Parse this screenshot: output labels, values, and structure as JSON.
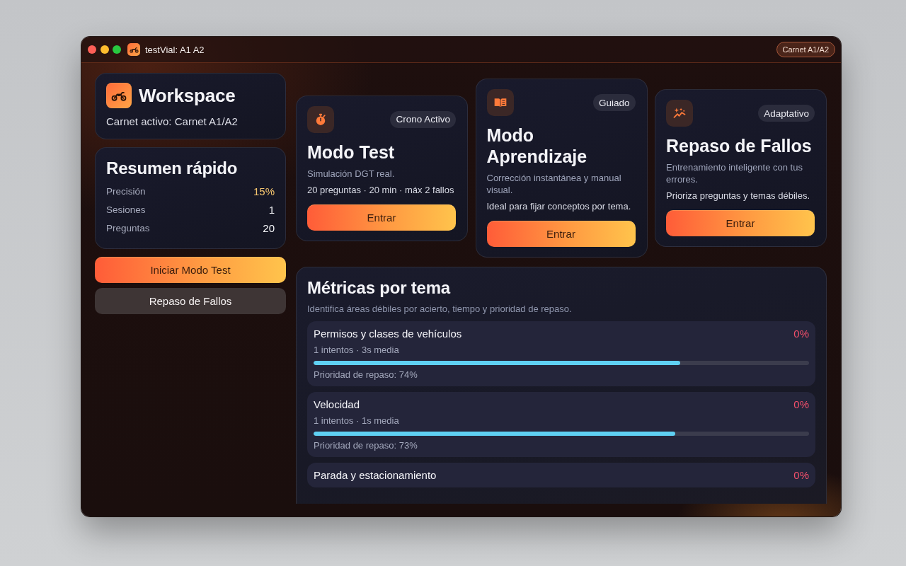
{
  "window": {
    "title": "testVial: A1 A2",
    "badge": "Carnet A1/A2"
  },
  "workspace": {
    "title": "Workspace",
    "subtitle": "Carnet activo: Carnet A1/A2"
  },
  "summary": {
    "title": "Resumen rápido",
    "stats": [
      {
        "label": "Precisión",
        "value": "15%",
        "color": "#f7c66f"
      },
      {
        "label": "Sesiones",
        "value": "1",
        "color": "#f4f5f8"
      },
      {
        "label": "Preguntas",
        "value": "20",
        "color": "#f4f5f8"
      }
    ]
  },
  "actions": [
    {
      "label": "Iniciar Modo Test",
      "kind": "primary"
    },
    {
      "label": "Repaso de Fallos",
      "kind": "secondary"
    }
  ],
  "modes": [
    {
      "badge": "Crono Activo",
      "title": "Modo Test",
      "description": "Simulación DGT real.",
      "detail": "20 preguntas · 20 min · máx 2 fallos",
      "button": "Entrar"
    },
    {
      "badge": "Guiado",
      "title": "Modo Aprendizaje",
      "description": "Corrección instantánea y manual visual.",
      "detail": "Ideal para fijar conceptos por tema.",
      "button": "Entrar"
    },
    {
      "badge": "Adaptativo",
      "title": "Repaso de Fallos",
      "description": "Entrenamiento inteligente con tus errores.",
      "detail": "Prioriza preguntas y temas débiles.",
      "button": "Entrar"
    }
  ],
  "metrics": {
    "title": "Métricas por tema",
    "subtitle": "Identifica áreas débiles por acierto, tiempo y prioridad de repaso.",
    "topics": [
      {
        "name": "Permisos y clases de vehículos",
        "score": "0%",
        "stats": "1 intentos · 3s media",
        "level": 0.74,
        "priority": "Prioridad de repaso: 74%"
      },
      {
        "name": "Velocidad",
        "score": "0%",
        "stats": "1 intentos · 1s media",
        "level": 0.73,
        "priority": "Prioridad de repaso: 73%"
      },
      {
        "name": "Parada y estacionamiento",
        "score": "0%"
      }
    ]
  }
}
